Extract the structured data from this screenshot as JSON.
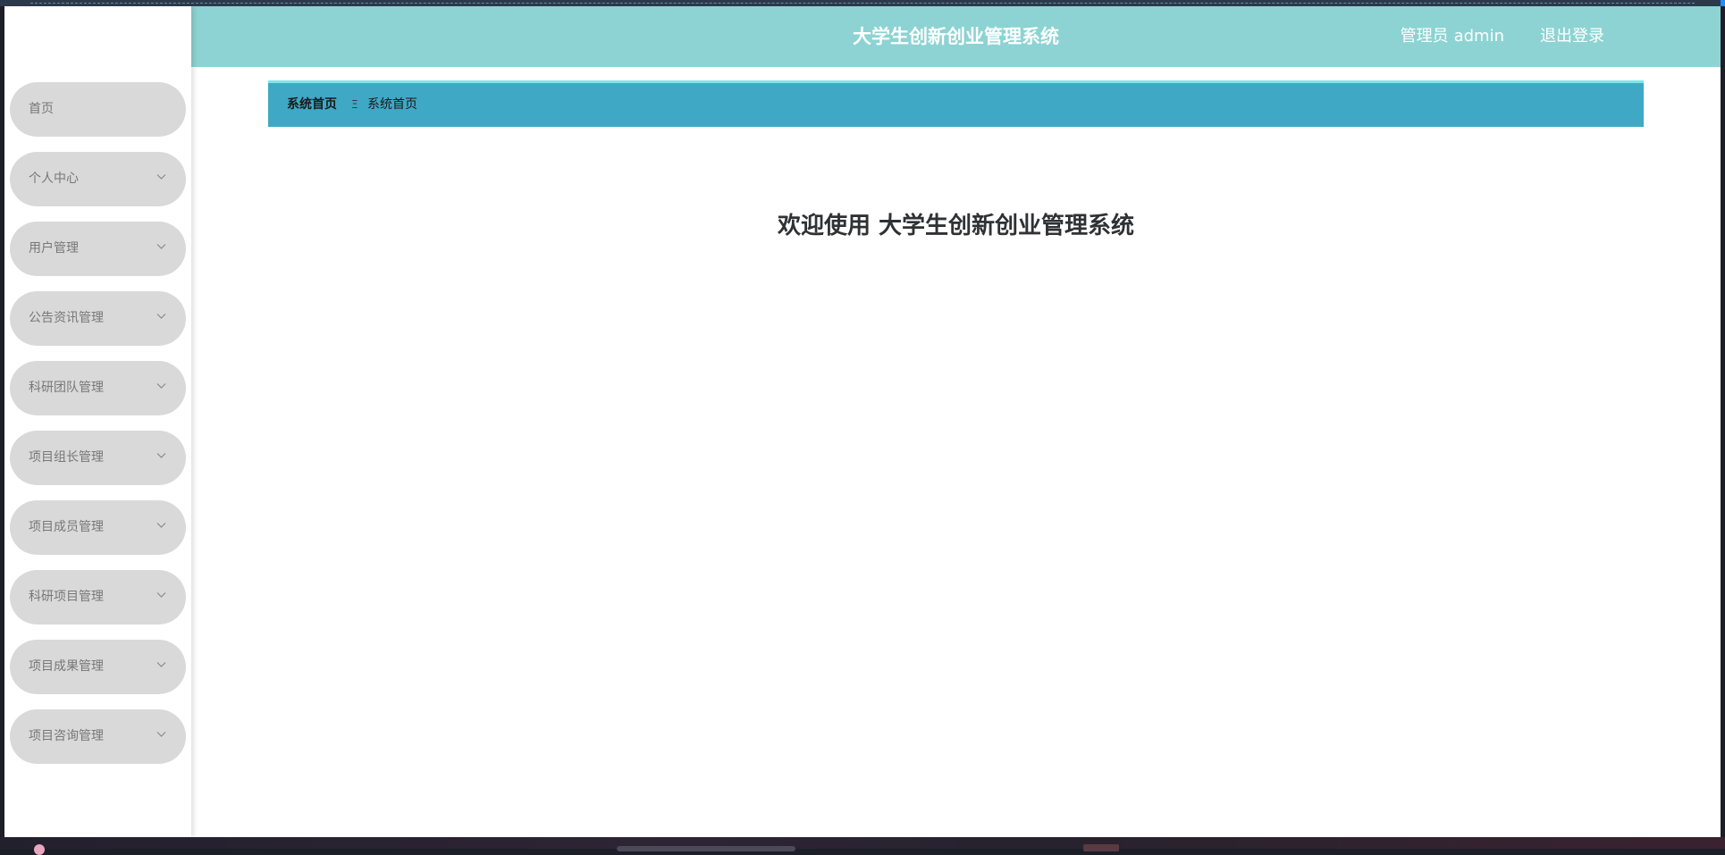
{
  "header": {
    "title": "大学生创新创业管理系统",
    "user_role": "管理员",
    "user_name": "admin",
    "logout_label": "退出登录"
  },
  "sidebar": {
    "items": [
      {
        "label": "首页",
        "has_submenu": false
      },
      {
        "label": "个人中心",
        "has_submenu": true
      },
      {
        "label": "用户管理",
        "has_submenu": true
      },
      {
        "label": "公告资讯管理",
        "has_submenu": true
      },
      {
        "label": "科研团队管理",
        "has_submenu": true
      },
      {
        "label": "项目组长管理",
        "has_submenu": true
      },
      {
        "label": "项目成员管理",
        "has_submenu": true
      },
      {
        "label": "科研项目管理",
        "has_submenu": true
      },
      {
        "label": "项目成果管理",
        "has_submenu": true
      },
      {
        "label": "项目咨询管理",
        "has_submenu": true
      }
    ]
  },
  "breadcrumb": {
    "home": "系统首页",
    "separator": "Ξ",
    "current": "系统首页"
  },
  "main": {
    "welcome_text": "欢迎使用 大学生创新创业管理系统"
  },
  "colors": {
    "header_bg": "#8dd3d3",
    "breadcrumb_bg": "#3fa8c5",
    "breadcrumb_accent": "#7ee6e6",
    "menu_item_bg": "#d9d9d9"
  }
}
